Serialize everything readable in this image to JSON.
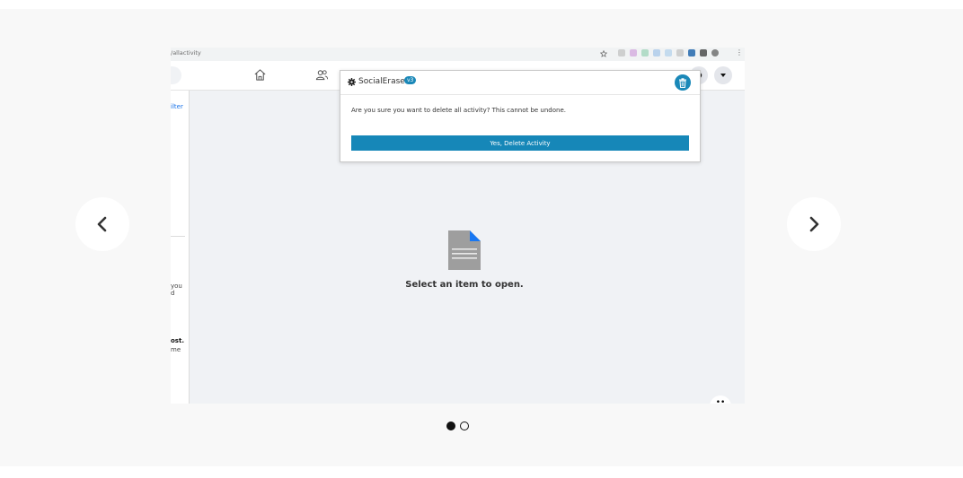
{
  "gallery": {
    "prev_icon": "chevron-left-icon",
    "next_icon": "chevron-right-icon",
    "dots": [
      {
        "name": "slide-dot-1",
        "active": true
      },
      {
        "name": "slide-dot-2",
        "active": false
      }
    ]
  },
  "browser": {
    "url": "/allactivity",
    "extension_colors": [
      "#b0b0b0",
      "#c78ad6",
      "#7fc9a4",
      "#8ab6e6",
      "#9ec7ea",
      "#b0b0b0",
      "#2d6fb0",
      "#444444",
      "#555555"
    ]
  },
  "facebook": {
    "left_stubs": {
      "filter": "ilter",
      "you_1": "you",
      "you_2": "d",
      "post_1": "ost.",
      "post_2": "me"
    },
    "empty_state": {
      "label": "Select an item to open."
    },
    "corner_badge": "••"
  },
  "popup": {
    "brand": "SocialErase",
    "version": "v3",
    "confirm_text": "Are you sure you want to delete all activity? This cannot be undone.",
    "confirm_button": "Yes, Delete Activity"
  },
  "colors": {
    "accent": "#1687b8",
    "background": "#f8f8f8",
    "feed_bg": "#f0f2f5"
  }
}
